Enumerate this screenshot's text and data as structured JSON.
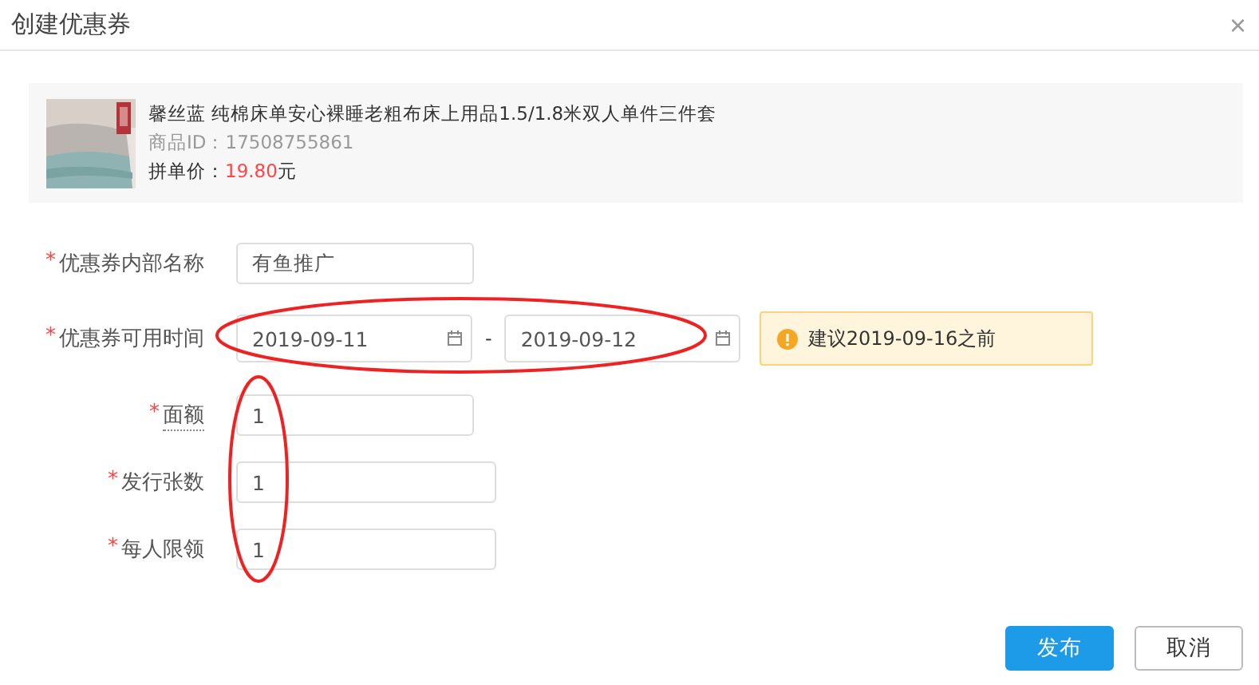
{
  "window": {
    "title": "创建优惠券",
    "close": "×"
  },
  "product": {
    "name": "馨丝蓝 纯棉床单安心裸睡老粗布床上用品1.5/1.8米双人单件三件套",
    "id_label": "商品ID：",
    "id": "17508755861",
    "price_label": "拼单价：",
    "price": "19.80",
    "price_unit": "元"
  },
  "form": [
    {
      "kind": "text",
      "label": "优惠券内部名称",
      "required": "*",
      "underline": false,
      "value": "有鱼推广"
    },
    {
      "kind": "daterange",
      "label": "优惠券可用时间",
      "required": "*",
      "underline": false,
      "start": "2019-09-11",
      "separator": "-",
      "end": "2019-09-12",
      "tip": "建议2019-09-16之前"
    },
    {
      "kind": "text",
      "label": "面额",
      "required": "*",
      "underline": true,
      "value": "1"
    },
    {
      "kind": "text",
      "label": "发行张数",
      "required": "*",
      "underline": false,
      "value": "1"
    },
    {
      "kind": "text",
      "label": "每人限领",
      "required": "*",
      "underline": false,
      "value": "1"
    }
  ],
  "buttons": [
    {
      "label": "发布",
      "kind": "primary"
    },
    {
      "label": "取消",
      "kind": "default"
    }
  ]
}
